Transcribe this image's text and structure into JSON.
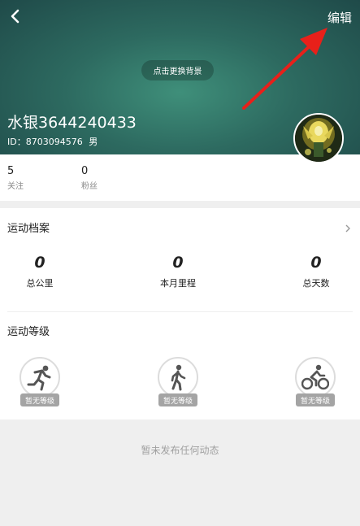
{
  "header": {
    "edit_label": "编辑",
    "change_background_label": "点击更换背景",
    "username": "水银3644240433",
    "user_id": "ID：8703094576",
    "gender": "男"
  },
  "stats": [
    {
      "value": "5",
      "label": "关注"
    },
    {
      "value": "0",
      "label": "粉丝"
    }
  ],
  "sport_profile": {
    "title": "运动档案",
    "metrics": [
      {
        "value": "0",
        "label": "总公里"
      },
      {
        "value": "0",
        "label": "本月里程"
      },
      {
        "value": "0",
        "label": "总天数"
      }
    ]
  },
  "sport_level": {
    "title": "运动等级",
    "levels": [
      {
        "icon": "running-icon",
        "badge": "暂无等级"
      },
      {
        "icon": "walking-icon",
        "badge": "暂无等级"
      },
      {
        "icon": "cycling-icon",
        "badge": "暂无等级"
      }
    ]
  },
  "feed": {
    "empty_text": "暂未发布任何动态"
  },
  "colors": {
    "header_bg": "#2d6a60",
    "annotation_arrow": "#e8201a",
    "badge_bg": "#a4a4a4"
  }
}
